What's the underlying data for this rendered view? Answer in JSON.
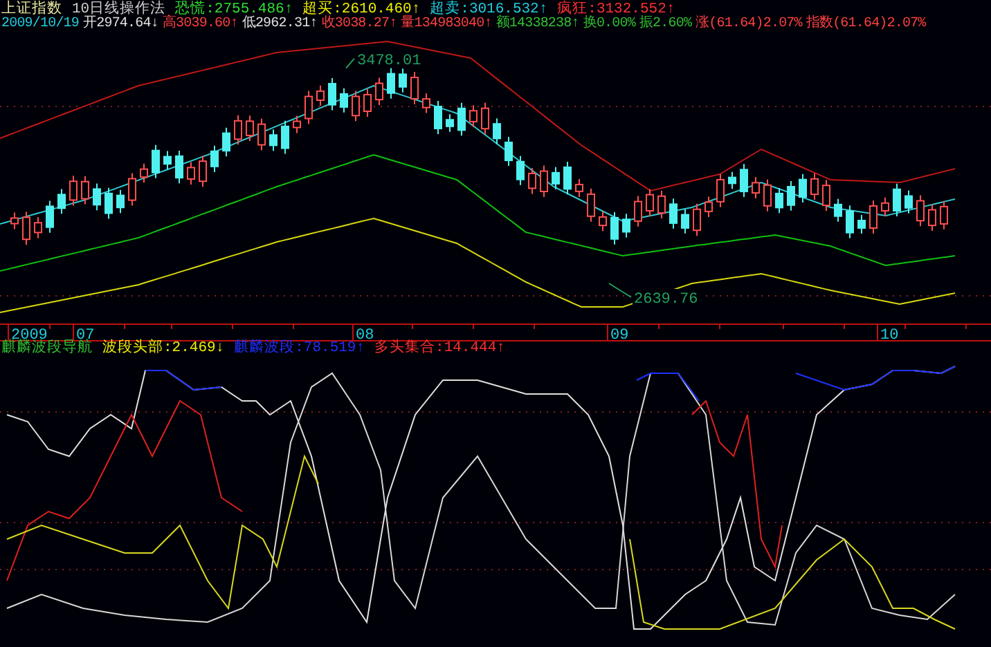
{
  "header_line_1": [
    {
      "text": "上证指数",
      "color": "#e8e8a0"
    },
    {
      "text": "10日线操作法",
      "color": "#d0d0d0"
    },
    {
      "text": "恐慌:2755.486↑",
      "color": "#30e030"
    },
    {
      "text": "超买:2610.460↑",
      "color": "#f0f000"
    },
    {
      "text": "超卖:3016.532↑",
      "color": "#20d0e0"
    },
    {
      "text": "疯狂:3132.552↑",
      "color": "#ff3030"
    }
  ],
  "header_line_2": [
    {
      "text": "2009/10/19",
      "color": "#20d0e0"
    },
    {
      "text": "开2974.64↓",
      "color": "#e0e0e0"
    },
    {
      "text": "高3039.60↑",
      "color": "#ff4040"
    },
    {
      "text": "低2962.31↑",
      "color": "#e0e0e0"
    },
    {
      "text": "收3038.27↑",
      "color": "#ff4040"
    },
    {
      "text": "量134983040↑",
      "color": "#ff4040"
    },
    {
      "text": "额14338238↑",
      "color": "#30c030"
    },
    {
      "text": "换0.00%",
      "color": "#30c030"
    },
    {
      "text": "振2.60%",
      "color": "#30c030"
    },
    {
      "text": "涨(61.64)2.07%",
      "color": "#ff4040"
    },
    {
      "text": "指数(61.64)2.07%",
      "color": "#ff4040"
    }
  ],
  "price_labels": [
    "3478.01",
    "2639.76"
  ],
  "time_axis": [
    "2009",
    "07",
    "08",
    "09",
    "10"
  ],
  "indicator_legend": [
    {
      "text": "麒麟波段导航",
      "color": "#30c030"
    },
    {
      "text": "波段头部:2.469↓",
      "color": "#f0f000"
    },
    {
      "text": "麒麟波段:78.519↑",
      "color": "#2030ff"
    },
    {
      "text": "多头集合:14.444↑",
      "color": "#ff3030"
    }
  ]
}
